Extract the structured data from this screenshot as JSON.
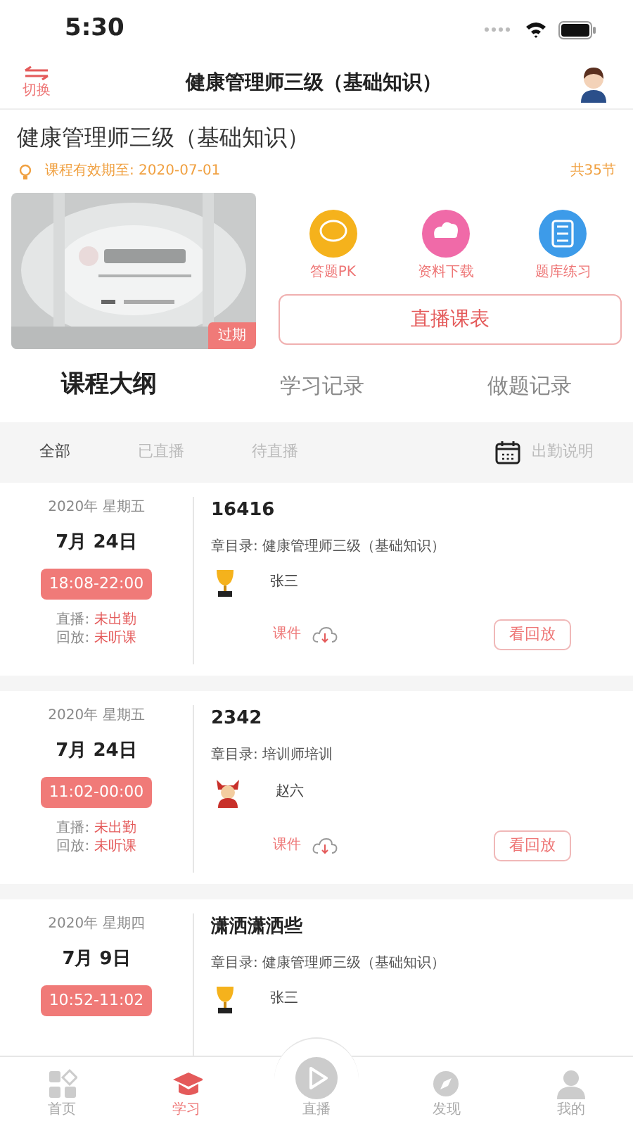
{
  "status_bar": {
    "time": "5:30"
  },
  "header": {
    "switch_label": "切换",
    "title": "健康管理师三级（基础知识）"
  },
  "course": {
    "title": "健康管理师三级（基础知识）",
    "validity": "课程有效期至: 2020-07-01",
    "lesson_count": "共35节",
    "badge": "过期",
    "actions": [
      {
        "kind": "pk",
        "label": "答题PK",
        "color": "#f5b21c"
      },
      {
        "kind": "download",
        "label": "资料下载",
        "color": "#f06aa8"
      },
      {
        "kind": "bank",
        "label": "题库练习",
        "color": "#3d9be9"
      }
    ],
    "schedule_button": "直播课表"
  },
  "tabs": [
    {
      "label": "课程大纲",
      "selected": true
    },
    {
      "label": "学习记录",
      "selected": false
    },
    {
      "label": "做题记录",
      "selected": false
    }
  ],
  "filters": [
    {
      "label": "全部",
      "selected": true
    },
    {
      "label": "已直播",
      "selected": false
    },
    {
      "label": "待直播",
      "selected": false
    }
  ],
  "attendance_link": "出勤说明",
  "lessons": [
    {
      "year_week": "2020年 星期五",
      "date": "7月 24日",
      "time": "18:08-22:00",
      "title": "16416",
      "chapter": "章目录: 健康管理师三级（基础知识）",
      "teacher": {
        "kind": "trophy",
        "name": "张三"
      },
      "status": [
        {
          "label": "直播: ",
          "value": "未出勤"
        },
        {
          "label": "回放: ",
          "value": "未听课"
        }
      ],
      "courseware": "课件",
      "replay": "看回放"
    },
    {
      "year_week": "2020年 星期五",
      "date": "7月 24日",
      "time": "11:02-00:00",
      "title": "2342",
      "chapter": "章目录: 培训师培训",
      "teacher": {
        "kind": "figure",
        "name": "赵六"
      },
      "status": [
        {
          "label": "直播: ",
          "value": "未出勤"
        },
        {
          "label": "回放: ",
          "value": "未听课"
        }
      ],
      "courseware": "课件",
      "replay": "看回放"
    },
    {
      "year_week": "2020年 星期四",
      "date": "7月 9日",
      "time": "10:52-11:02",
      "title": "潇洒潇洒些",
      "chapter": "章目录: 健康管理师三级（基础知识）",
      "teacher": {
        "kind": "trophy",
        "name": "张三"
      }
    }
  ],
  "tab_bar": [
    {
      "kind": "home",
      "label": "首页",
      "selected": false
    },
    {
      "kind": "study",
      "label": "学习",
      "selected": true
    },
    {
      "kind": "live",
      "label": "直播",
      "selected": false
    },
    {
      "kind": "discover",
      "label": "发现",
      "selected": false
    },
    {
      "kind": "me",
      "label": "我的",
      "selected": false
    }
  ]
}
